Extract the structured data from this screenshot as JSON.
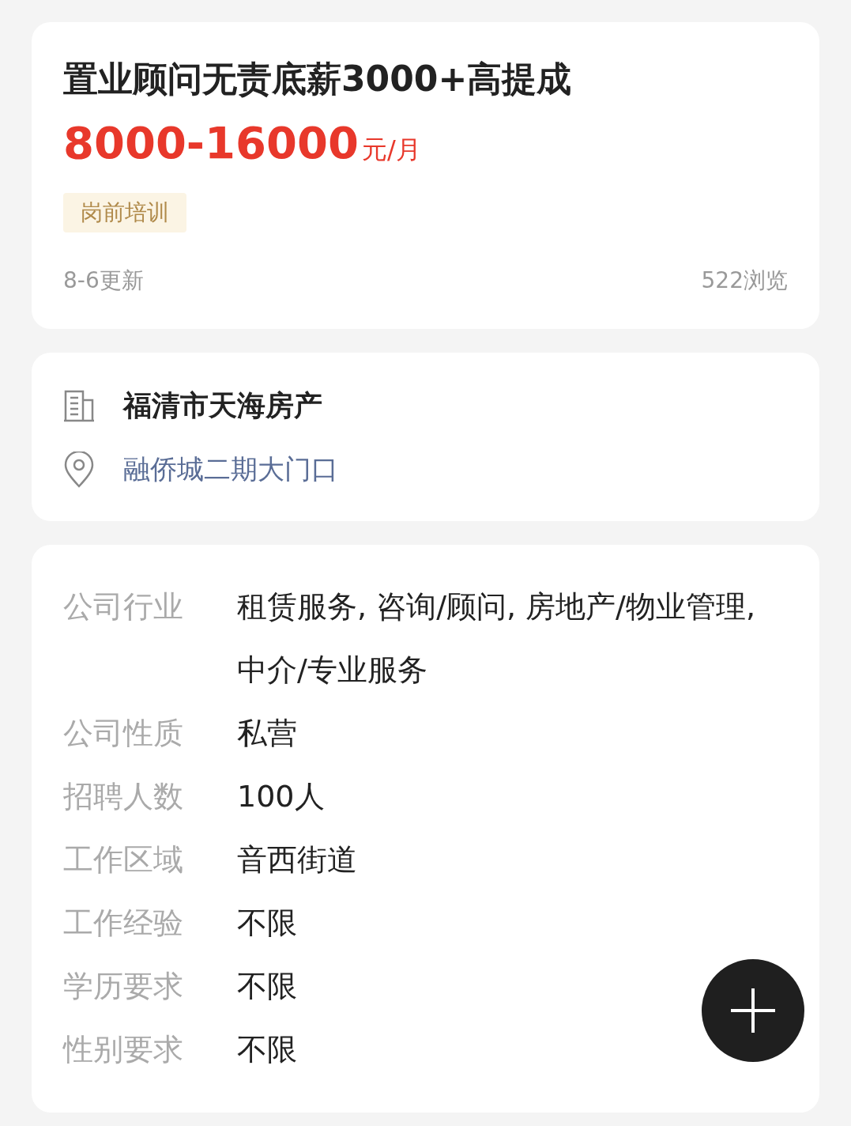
{
  "job": {
    "title": "置业顾问无责底薪3000+高提成",
    "salary": "8000-16000",
    "salary_unit": "元/月",
    "tags": [
      "岗前培训"
    ],
    "updated": "8-6更新",
    "views": "522浏览"
  },
  "company": {
    "name": "福清市天海房产",
    "address": "融侨城二期大门口"
  },
  "details": [
    {
      "label": "公司行业",
      "value": "租赁服务, 咨询/顾问, 房地产/物业管理, 中介/专业服务"
    },
    {
      "label": "公司性质",
      "value": "私营"
    },
    {
      "label": "招聘人数",
      "value": "100人"
    },
    {
      "label": "工作区域",
      "value": "音西街道"
    },
    {
      "label": "工作经验",
      "value": "不限"
    },
    {
      "label": "学历要求",
      "value": "不限"
    },
    {
      "label": "性别要求",
      "value": "不限"
    }
  ]
}
